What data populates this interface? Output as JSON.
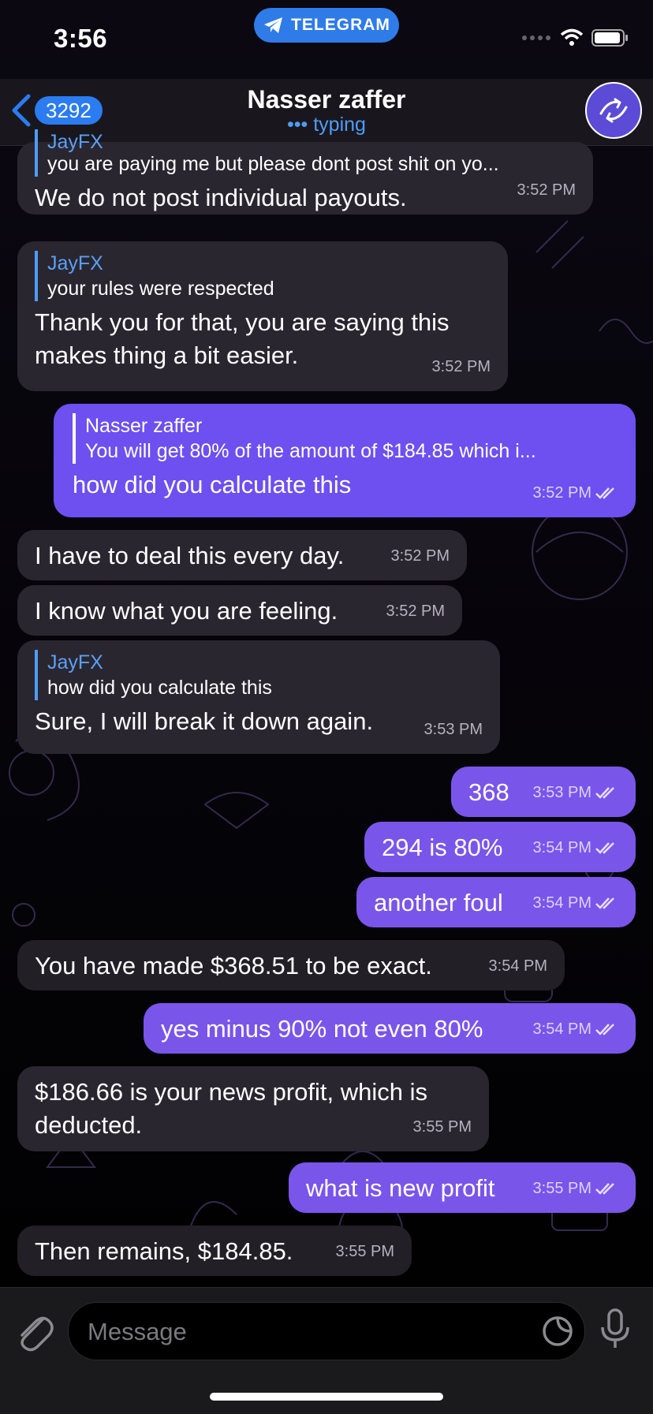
{
  "status_bar": {
    "time": "3:56",
    "pill_label": "TELEGRAM"
  },
  "header": {
    "back_count": "3292",
    "title": "Nasser zaffer",
    "subtitle": "••• typing"
  },
  "messages": [
    {
      "text": "We do not post individual payouts.",
      "time": "3:52 PM",
      "reply_name": "JayFX",
      "reply_text": "you are paying me but please dont post shit on yo..."
    },
    {
      "text": "Thank you for that, you are saying this makes thing a bit easier.",
      "time": "3:52 PM",
      "reply_name": "JayFX",
      "reply_text": "your rules were respected"
    },
    {
      "text": "how did you calculate this",
      "time": "3:52 PM",
      "reply_name": "Nasser zaffer",
      "reply_text": "You will get 80% of the amount of $184.85 which i..."
    },
    {
      "text": "I have to deal this every day.",
      "time": "3:52 PM"
    },
    {
      "text": "I know what you are feeling.",
      "time": "3:52 PM"
    },
    {
      "text": "Sure, I will break it down again.",
      "time": "3:53 PM",
      "reply_name": "JayFX",
      "reply_text": "how did you calculate this"
    },
    {
      "text": "368",
      "time": "3:53 PM"
    },
    {
      "text": "294 is 80%",
      "time": "3:54 PM"
    },
    {
      "text": "another foul",
      "time": "3:54 PM"
    },
    {
      "text": "You have made $368.51 to be exact.",
      "time": "3:54 PM"
    },
    {
      "text": "yes minus 90% not even 80%",
      "time": "3:54 PM"
    },
    {
      "text": "$186.66 is your news profit, which is deducted.",
      "time": "3:55 PM"
    },
    {
      "text": "what is new profit",
      "time": "3:55 PM"
    },
    {
      "text": "Then remains, $184.85.",
      "time": "3:55 PM"
    }
  ],
  "input": {
    "placeholder": "Message"
  }
}
